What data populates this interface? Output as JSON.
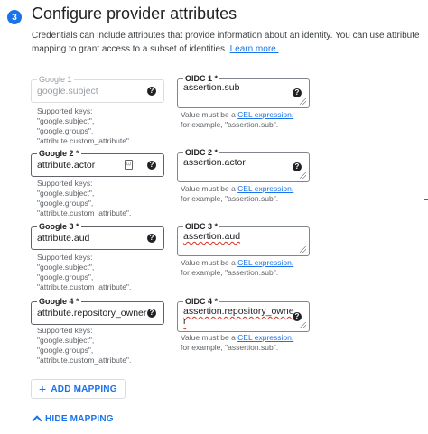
{
  "header": {
    "step": "3",
    "title": "Configure provider attributes",
    "description": "Credentials can include attributes that provide information about an identity. You can use attribute mapping to grant access to a subset of identities.",
    "learn_more": "Learn more."
  },
  "help_text": {
    "supported_keys": "Supported keys:",
    "key_subject": "\"google.subject\",",
    "key_groups": "\"google.groups\",",
    "key_custom": "\"attribute.custom_attribute\".",
    "value_prefix": "Value must be a",
    "cel_link": "CEL expression,",
    "value_example": "for example, \"assertion.sub\"."
  },
  "mappings": [
    {
      "google_label": "Google 1",
      "google_value": "google.subject",
      "oidc_label": "OIDC 1 *",
      "oidc_value": "assertion.sub"
    },
    {
      "google_label": "Google 2 *",
      "google_value": "attribute.actor",
      "oidc_label": "OIDC 2 *",
      "oidc_value": "assertion.actor"
    },
    {
      "google_label": "Google 3 *",
      "google_value": "attribute.aud",
      "oidc_label": "OIDC 3 *",
      "oidc_value": "assertion.aud"
    },
    {
      "google_label": "Google 4 *",
      "google_value": "attribute.repository_owner",
      "oidc_label": "OIDC 4 *",
      "oidc_value_line1": "assertion.repository_owne",
      "oidc_value_line2": "r"
    }
  ],
  "icons": {
    "help": "?",
    "key_badge": "⊡"
  },
  "actions": {
    "add_mapping": "ADD MAPPING",
    "add_icon": "+",
    "hide_mapping": "HIDE MAPPING"
  },
  "colors": {
    "accent": "#1a73e8",
    "step_badge": "#1a73e8",
    "error": "#d93025",
    "link": "#1a73e8",
    "link_visited": "#681da8"
  }
}
